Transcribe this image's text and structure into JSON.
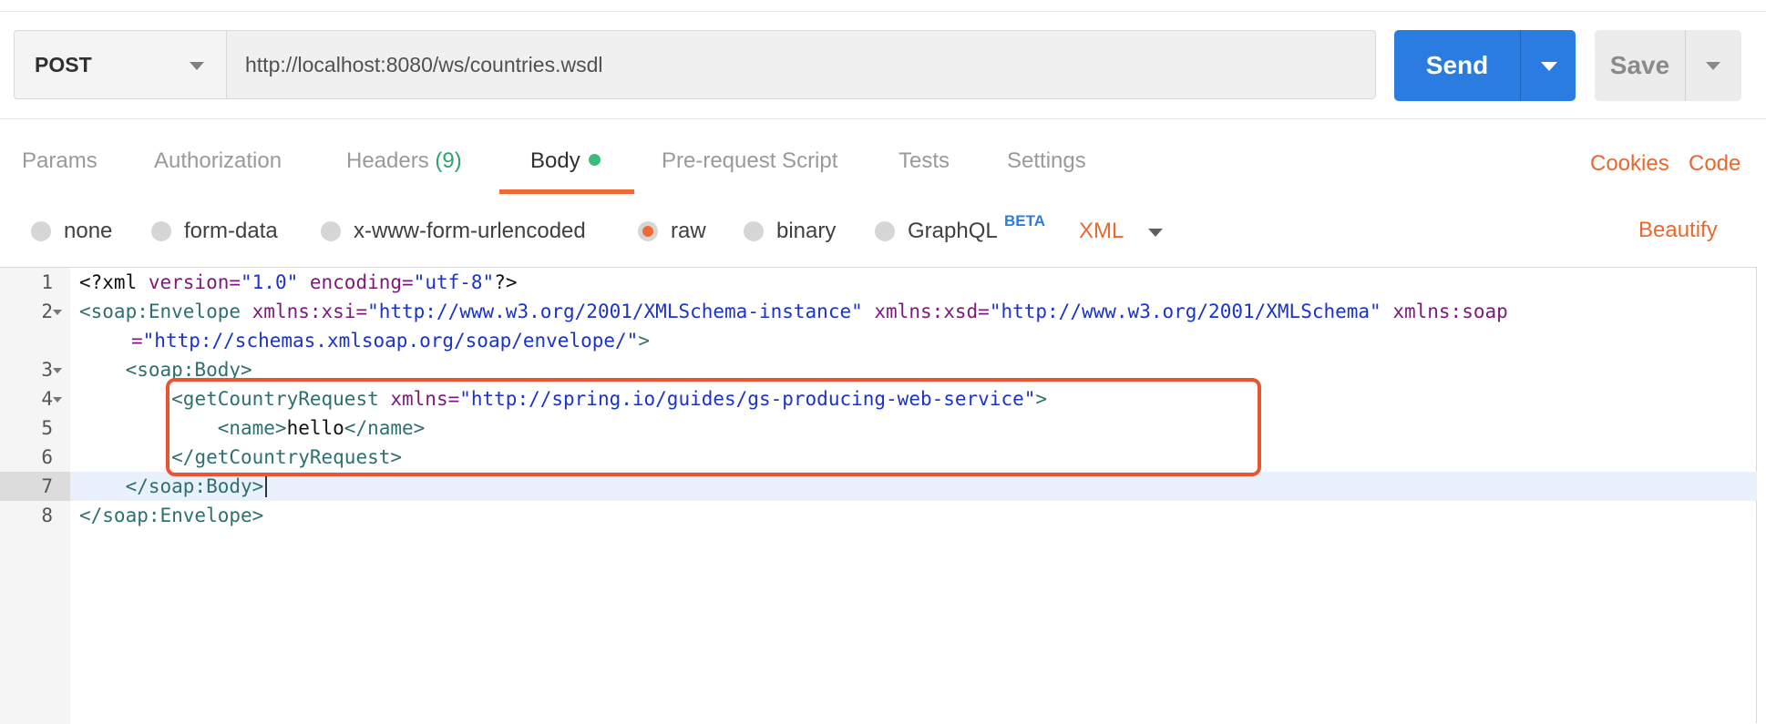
{
  "request": {
    "method": "POST",
    "url": "http://localhost:8080/ws/countries.wsdl",
    "send_label": "Send",
    "save_label": "Save"
  },
  "tabs": {
    "params": "Params",
    "authorization": "Authorization",
    "headers": "Headers",
    "headers_count": "(9)",
    "body": "Body",
    "prerequest": "Pre-request Script",
    "tests": "Tests",
    "settings": "Settings",
    "active": "Body"
  },
  "links": {
    "cookies": "Cookies",
    "code": "Code"
  },
  "body_types": {
    "none": "none",
    "form_data": "form-data",
    "urlencoded": "x-www-form-urlencoded",
    "raw": "raw",
    "binary": "binary",
    "graphql": "GraphQL",
    "beta_badge": "BETA",
    "selected": "raw",
    "format": "XML",
    "beautify": "Beautify"
  },
  "editor": {
    "active_line": 7,
    "line_numbers": [
      "1",
      "2",
      "3",
      "4",
      "5",
      "6",
      "7",
      "8"
    ],
    "lines": {
      "l1": {
        "open": "<?xml ",
        "attr1": "version=",
        "val1": "\"1.0\"",
        "attr2": " encoding=",
        "val2": "\"utf-8\"",
        "close": "?>"
      },
      "l2": {
        "tag": "<soap:Envelope ",
        "attr1": "xmlns:xsi=",
        "val1": "\"http://www.w3.org/2001/XMLSchema-instance\"",
        "attr2": " xmlns:xsd=",
        "val2": "\"http://www.w3.org/2001/XMLSchema\"",
        "attr3": " xmlns:soap"
      },
      "l2b": {
        "eq": "=",
        "val": "\"http://schemas.xmlsoap.org/soap/envelope/\"",
        "close": ">"
      },
      "l3": {
        "indent": "    ",
        "tag": "<soap:Body>"
      },
      "l4": {
        "indent": "        ",
        "tag": "<getCountryRequest ",
        "attr": "xmlns=",
        "val": "\"http://spring.io/guides/gs-producing-web-service\"",
        "close": ">"
      },
      "l5": {
        "indent": "            ",
        "open": "<name>",
        "text": "hello",
        "close": "</name>"
      },
      "l6": {
        "indent": "        ",
        "tag": "</getCountryRequest>"
      },
      "l7": {
        "indent": "    ",
        "tag": "</soap:Body>"
      },
      "l8": {
        "tag": "</soap:Envelope>"
      }
    }
  },
  "colors": {
    "send": "#2a7ce0",
    "accent_orange": "#f06a35",
    "annotation_box": "#ea5530",
    "status_dot": "#3dbb7a"
  }
}
